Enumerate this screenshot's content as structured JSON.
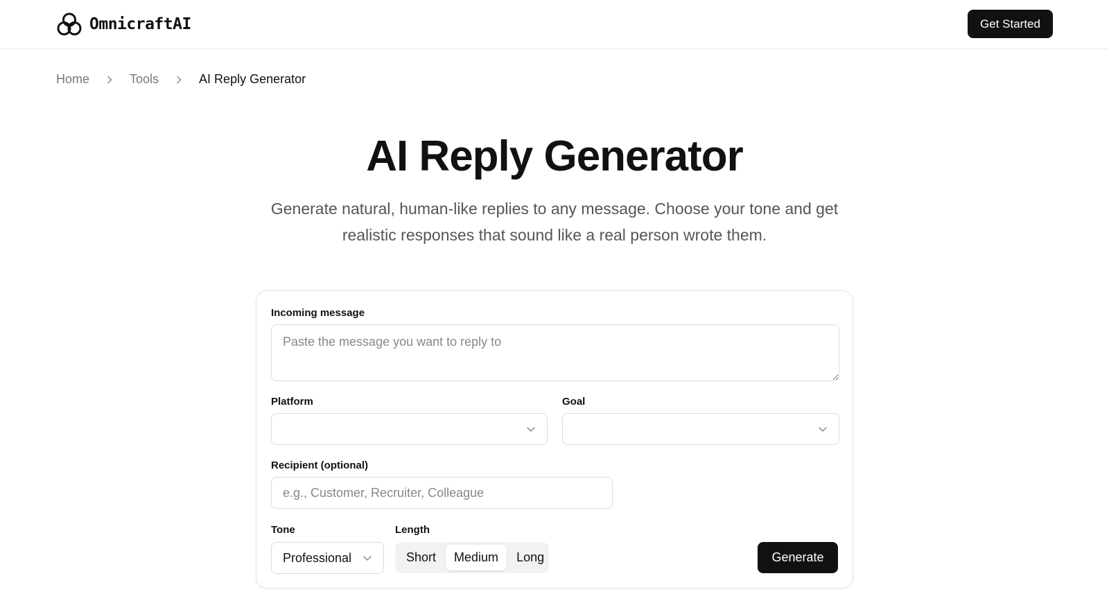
{
  "header": {
    "brand_name": "OmnicraftAI",
    "logo_icon": "interlocking-rings-logo",
    "cta_label": "Get Started"
  },
  "breadcrumb": {
    "items": [
      "Home",
      "Tools",
      "AI Reply Generator"
    ]
  },
  "hero": {
    "title": "AI Reply Generator",
    "subtitle": "Generate natural, human-like replies to any message. Choose your tone and get realistic responses that sound like a real person wrote them."
  },
  "form": {
    "incoming_message": {
      "label": "Incoming message",
      "placeholder": "Paste the message you want to reply to",
      "value": ""
    },
    "platform": {
      "label": "Platform",
      "value": ""
    },
    "goal": {
      "label": "Goal",
      "value": ""
    },
    "recipient": {
      "label": "Recipient (optional)",
      "placeholder": "e.g., Customer, Recruiter, Colleague",
      "value": ""
    },
    "tone": {
      "label": "Tone",
      "value": "Professional"
    },
    "length": {
      "label": "Length",
      "options": [
        "Short",
        "Medium",
        "Long"
      ],
      "selected": "Medium"
    },
    "generate_label": "Generate"
  },
  "colors": {
    "primary": "#111111",
    "muted_text": "#777777",
    "border": "#dcdcdc",
    "segment_bg": "#f2f2f2"
  }
}
